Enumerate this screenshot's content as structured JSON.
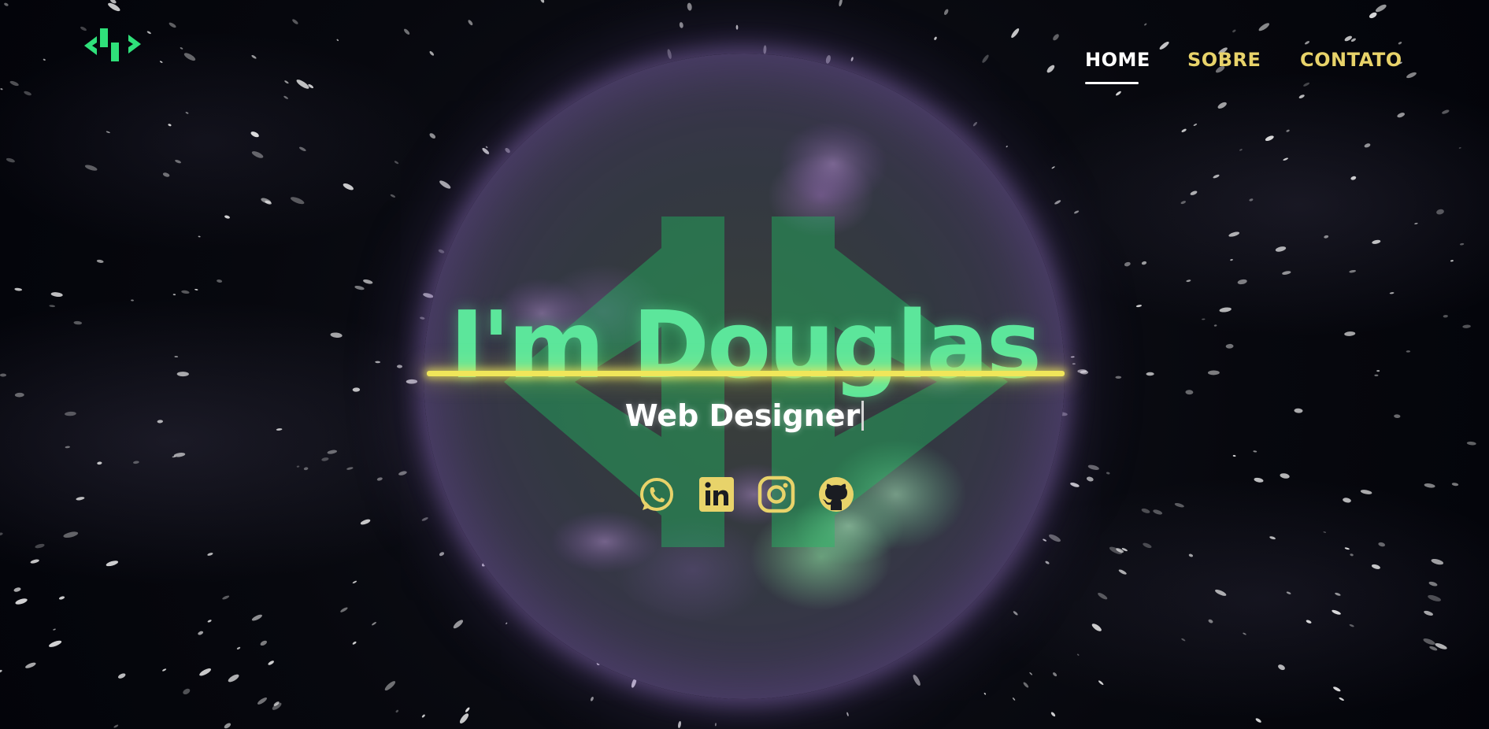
{
  "logo": {
    "icon": "code-brackets-logo-icon",
    "color": "#2fe07a"
  },
  "nav": {
    "items": [
      {
        "label": "HOME",
        "active": true
      },
      {
        "label": "SOBRE",
        "active": false
      },
      {
        "label": "CONTATO",
        "active": false
      }
    ]
  },
  "hero": {
    "title": "I'm Douglas",
    "subtitle": "Web Designer"
  },
  "socials": [
    {
      "icon": "whatsapp-icon"
    },
    {
      "icon": "linkedin-icon"
    },
    {
      "icon": "instagram-icon"
    },
    {
      "icon": "github-icon"
    }
  ],
  "colors": {
    "accent_green": "#5ce69b",
    "accent_yellow": "#e8d36a",
    "divider_yellow": "#f0e65a",
    "background": "#05060b"
  }
}
